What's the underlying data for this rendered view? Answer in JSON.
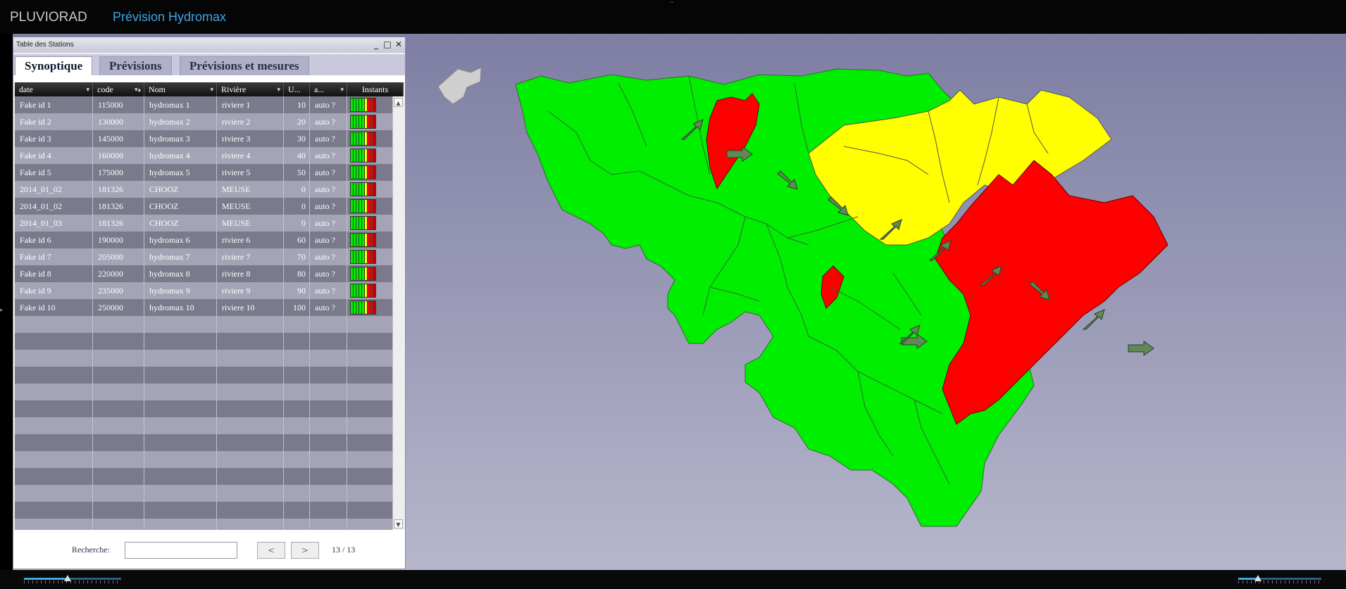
{
  "app": {
    "title": "PLUVIORAD",
    "subtitle": "Prévision Hydromax"
  },
  "colors": {
    "green": "#00ee00",
    "yellow": "#ffff00",
    "red": "#ff0000",
    "arrow": "#6d8a5a",
    "accent": "#3ea6e6"
  },
  "panel": {
    "title": "Table des Stations",
    "tabs": [
      "Synoptique",
      "Prévisions",
      "Prévisions et mesures"
    ],
    "active_tab": "Synoptique",
    "columns": [
      "date",
      "code",
      "Nom",
      "Rivière",
      "U...",
      "a...",
      "Instants"
    ],
    "rows": [
      [
        "Fake id 1",
        "115000",
        "hydromax 1",
        "riviere 1",
        "10",
        "auto ?"
      ],
      [
        "Fake id 2",
        "130000",
        "hydromax 2",
        "riviere 2",
        "20",
        "auto ?"
      ],
      [
        "Fake id 3",
        "145000",
        "hydromax 3",
        "riviere 3",
        "30",
        "auto ?"
      ],
      [
        "Fake id 4",
        "160000",
        "hydromax 4",
        "riviere 4",
        "40",
        "auto ?"
      ],
      [
        "Fake id 5",
        "175000",
        "hydromax 5",
        "riviere 5",
        "50",
        "auto ?"
      ],
      [
        "2014_01_02",
        "181326",
        "CHOOZ",
        "MEUSE",
        "0",
        "auto ?"
      ],
      [
        "2014_01_02",
        "181326",
        "CHOOZ",
        "MEUSE",
        "0",
        "auto ?"
      ],
      [
        "2014_01_03",
        "181326",
        "CHOOZ",
        "MEUSE",
        "0",
        "auto ?"
      ],
      [
        "Fake id 6",
        "190000",
        "hydromax 6",
        "riviere 6",
        "60",
        "auto ?"
      ],
      [
        "Fake id 7",
        "205000",
        "hydromax 7",
        "riviere 7",
        "70",
        "auto ?"
      ],
      [
        "Fake id 8",
        "220000",
        "hydromax 8",
        "riviere 8",
        "80",
        "auto ?"
      ],
      [
        "Fake id 9",
        "235000",
        "hydromax 9",
        "riviere 9",
        "90",
        "auto ?"
      ],
      [
        "Fake id 10",
        "250000",
        "hydromax 10",
        "riviere 10",
        "100",
        "auto ?"
      ]
    ],
    "instants_pattern": [
      "#00ee00",
      "#00ee00",
      "#00ee00",
      "#00ee00",
      "#00ee00",
      "#ffff00",
      "#ff0000",
      "#ff0000",
      "#cc0000"
    ],
    "search_label": "Recherche:",
    "search_value": "",
    "prev_label": "<",
    "next_label": ">",
    "pager": "13 / 13"
  },
  "sliders": {
    "left_fraction": 0.45,
    "right_fraction": 0.24
  }
}
